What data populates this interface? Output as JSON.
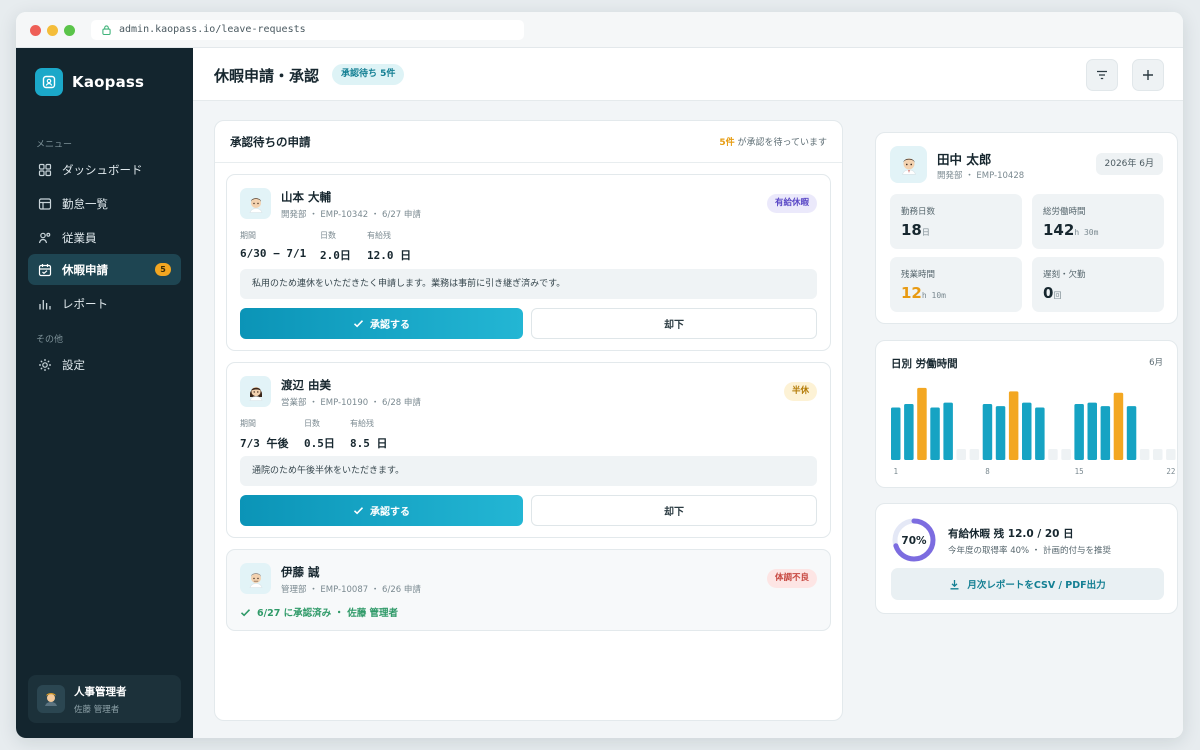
{
  "browser": {
    "url": "admin.kaopass.io/leave-requests"
  },
  "sidebar": {
    "brand": "Kaopass",
    "section_menu": "メニュー",
    "section_other": "その他",
    "items": [
      {
        "label": "ダッシュボード",
        "icon": "grid-icon"
      },
      {
        "label": "勤怠一覧",
        "icon": "table-icon"
      },
      {
        "label": "従業員",
        "icon": "users-icon"
      },
      {
        "label": "休暇申請",
        "icon": "calendar-icon",
        "active": true,
        "badge": "5"
      },
      {
        "label": "レポート",
        "icon": "bar-chart-icon"
      },
      {
        "label": "設定",
        "icon": "gear-icon"
      }
    ],
    "user": {
      "role": "人事管理者",
      "name": "佐藤 管理者"
    }
  },
  "header": {
    "title": "休暇申請・承認",
    "pending_chip": "承認待ち 5件"
  },
  "requests": {
    "title": "承認待ちの申請",
    "summary_count": "5件",
    "summary_text": " が承認を待っています",
    "field_labels": {
      "period": "期間",
      "days": "日数",
      "remaining": "有給残"
    },
    "approve_label": "承認する",
    "reject_label": "却下",
    "cards": [
      {
        "name": "山本 大輔",
        "meta": "開発部 ・ EMP-10342 ・ 6/27 申請",
        "tag": "有給休暇",
        "period": "6/30 − 7/1",
        "days": "2.0日",
        "remaining": "12.0 日",
        "note": "私用のため連休をいただきたく申請します。業務は事前に引き継ぎ済みです。"
      },
      {
        "name": "渡辺 由美",
        "meta": "営業部 ・ EMP-10190 ・ 6/28 申請",
        "tag": "半休",
        "period_date": "7/3 ",
        "period_suffix": "午後",
        "days": "0.5日",
        "remaining": "8.5 日",
        "note": "通院のため午後半休をいただきます。"
      },
      {
        "name": "伊藤 誠",
        "meta": "管理部 ・ EMP-10087 ・ 6/26 申請",
        "tag": "体調不良",
        "status": "6/27 に承認済み ・ 佐藤 管理者"
      }
    ]
  },
  "profile": {
    "name": "田中 太郎",
    "meta": "開発部 ・ EMP-10428",
    "month": "2026年 6月",
    "stats": [
      {
        "label": "勤務日数",
        "value": "18",
        "unit": "日"
      },
      {
        "label": "総労働時間",
        "value": "142",
        "unit": "h 30m"
      },
      {
        "label": "残業時間",
        "value": "12",
        "unit": "h 10m"
      },
      {
        "label": "遅刻・欠勤",
        "value": "0",
        "unit": "回"
      }
    ]
  },
  "chart_data": {
    "type": "bar",
    "title": "日別 労働時間",
    "period_label": "6月",
    "x": [
      1,
      2,
      3,
      4,
      5,
      6,
      7,
      8,
      9,
      10,
      11,
      12,
      13,
      14,
      15,
      16,
      17,
      18,
      19,
      20,
      21,
      22,
      23,
      24,
      25,
      26,
      27,
      28,
      29,
      30
    ],
    "values": [
      7.5,
      8,
      10.3,
      7.5,
      8.2,
      1,
      1,
      8,
      7.7,
      9.8,
      8.2,
      7.5,
      1,
      1,
      8,
      8.2,
      7.7,
      9.6,
      7.7,
      1,
      1,
      1,
      1,
      1,
      1,
      1,
      1,
      1,
      1,
      1
    ],
    "series_kind": [
      "n",
      "n",
      "o",
      "n",
      "n",
      "w",
      "w",
      "n",
      "n",
      "o",
      "n",
      "n",
      "w",
      "w",
      "n",
      "n",
      "n",
      "o",
      "n",
      "w",
      "w",
      "w",
      "w",
      "w",
      "w",
      "w",
      "w",
      "w",
      "w",
      "w"
    ],
    "tick_labels": [
      "1",
      "8",
      "15",
      "22",
      "30"
    ],
    "ylim": [
      0,
      11
    ],
    "colors": {
      "normal": "#16a3c3",
      "overtime": "#f3a722",
      "weekend": "#eef2f4"
    }
  },
  "leave": {
    "percent_label": "70%",
    "percent_value": 0.7,
    "title": "有給休暇 残 12.0 / 20 日",
    "sub": "今年度の取得率 40% ・ 計画的付与を推奨",
    "export_label": "月次レポートをCSV / PDF出力"
  }
}
